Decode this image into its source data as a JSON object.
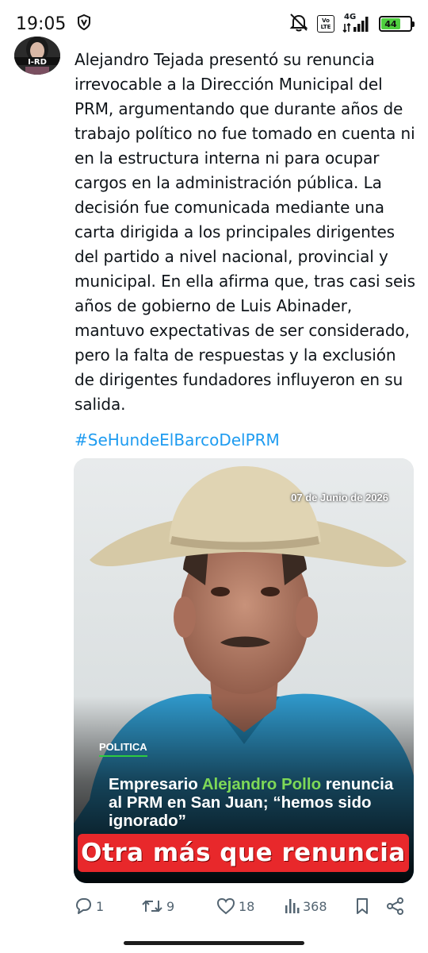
{
  "status_bar": {
    "time": "19:05",
    "lte_top": "Vo",
    "lte_bottom": "LTE",
    "network": "4G",
    "battery": "44",
    "battery_level": 0.44,
    "battery_color": "#4fcf3f"
  },
  "tweet": {
    "avatar_label": "I-RD",
    "text": "Alejandro Tejada presentó su renuncia irrevocable a la Dirección Municipal del PRM, argumentando que durante años de trabajo político no fue tomado en cuenta ni en la estructura interna ni para ocupar cargos en la administración pública. La decisión fue comunicada mediante una carta dirigida a los principales dirigentes del partido a nivel nacional, provincial y municipal. En ella afirma que, tras casi seis años de gobierno de Luis Abinader, mantuvo expectativas de ser considerado, pero la falta de respuestas y la exclusión de dirigentes fundadores influyeron en su salida.",
    "hashtag": "#SeHundeElBarcoDelPRM",
    "hashtag_color": "#1d9bf0"
  },
  "media": {
    "date": "07 de Junio de 2026",
    "section": "POLITICA",
    "headline_pre": "Empresario ",
    "headline_name": "Alejandro Pollo",
    "headline_rest": " renuncia al  PRM en San Juan; “hemos sido ignorado”",
    "banner": "Otra más que renuncia",
    "banner_color": "#e8282b",
    "name_color": "#7ed957"
  },
  "actions": {
    "replies": "1",
    "reposts": "9",
    "likes": "18",
    "views": "368",
    "icons": [
      "reply-icon",
      "repost-icon",
      "like-icon",
      "views-icon",
      "bookmark-icon",
      "share-icon"
    ]
  }
}
